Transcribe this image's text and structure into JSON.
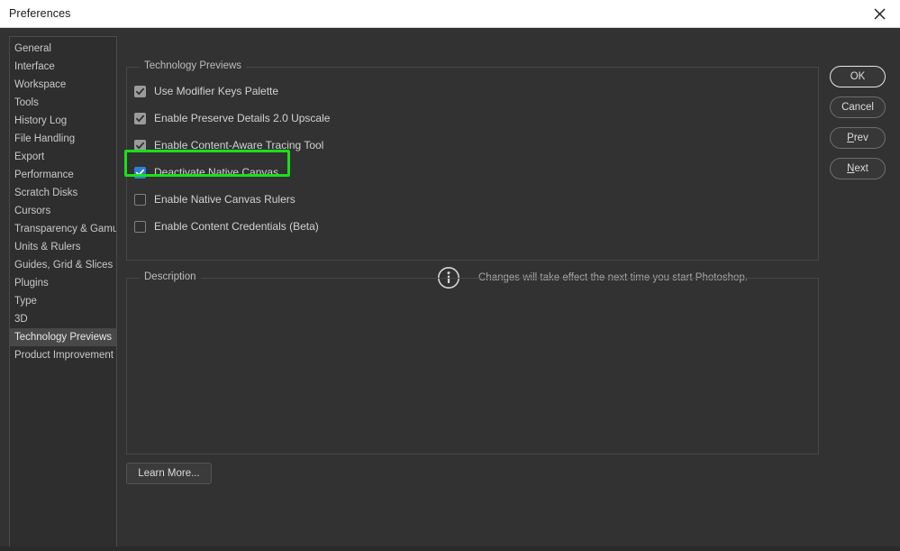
{
  "window": {
    "title": "Preferences",
    "close_icon": "close-icon"
  },
  "sidebar": {
    "items": [
      {
        "label": "General",
        "selected": false
      },
      {
        "label": "Interface",
        "selected": false
      },
      {
        "label": "Workspace",
        "selected": false
      },
      {
        "label": "Tools",
        "selected": false
      },
      {
        "label": "History Log",
        "selected": false
      },
      {
        "label": "File Handling",
        "selected": false
      },
      {
        "label": "Export",
        "selected": false
      },
      {
        "label": "Performance",
        "selected": false
      },
      {
        "label": "Scratch Disks",
        "selected": false
      },
      {
        "label": "Cursors",
        "selected": false
      },
      {
        "label": "Transparency & Gamut",
        "selected": false
      },
      {
        "label": "Units & Rulers",
        "selected": false
      },
      {
        "label": "Guides, Grid & Slices",
        "selected": false
      },
      {
        "label": "Plugins",
        "selected": false
      },
      {
        "label": "Type",
        "selected": false
      },
      {
        "label": "3D",
        "selected": false
      },
      {
        "label": "Technology Previews",
        "selected": true
      },
      {
        "label": "Product Improvement",
        "selected": false
      }
    ]
  },
  "tech_previews": {
    "group_title": "Technology Previews",
    "options": [
      {
        "label": "Use Modifier Keys Palette",
        "checked": true,
        "accent": false
      },
      {
        "label": "Enable Preserve Details 2.0 Upscale",
        "checked": true,
        "accent": false
      },
      {
        "label": "Enable Content-Aware Tracing Tool",
        "checked": true,
        "accent": false
      },
      {
        "label": "Deactivate Native Canvas",
        "checked": true,
        "accent": true
      },
      {
        "label": "Enable Native Canvas Rulers",
        "checked": false,
        "accent": false
      },
      {
        "label": "Enable Content Credentials (Beta)",
        "checked": false,
        "accent": false
      }
    ],
    "note": {
      "icon": "info-icon",
      "text": "Changes will take effect the next time you start Photoshop."
    }
  },
  "description": {
    "group_title": "Description",
    "body": ""
  },
  "learn_more": {
    "label": "Learn More..."
  },
  "buttons": {
    "ok": "OK",
    "cancel": "Cancel",
    "prev_accel": "P",
    "prev_rest": "rev",
    "next_accel": "N",
    "next_rest": "ext"
  },
  "annotation": {
    "highlight_target": "Deactivate Native Canvas",
    "highlight_color": "#1ae01a"
  },
  "colors": {
    "dialog_bg": "#323232",
    "titlebar_bg": "#ffffff",
    "sidebar_bg": "#2e2e2e",
    "selected_row": "#484848",
    "checkbox_accent": "#2e7fd4",
    "checkbox_gray": "#9b9b9b",
    "text": "#d2d2d2"
  }
}
